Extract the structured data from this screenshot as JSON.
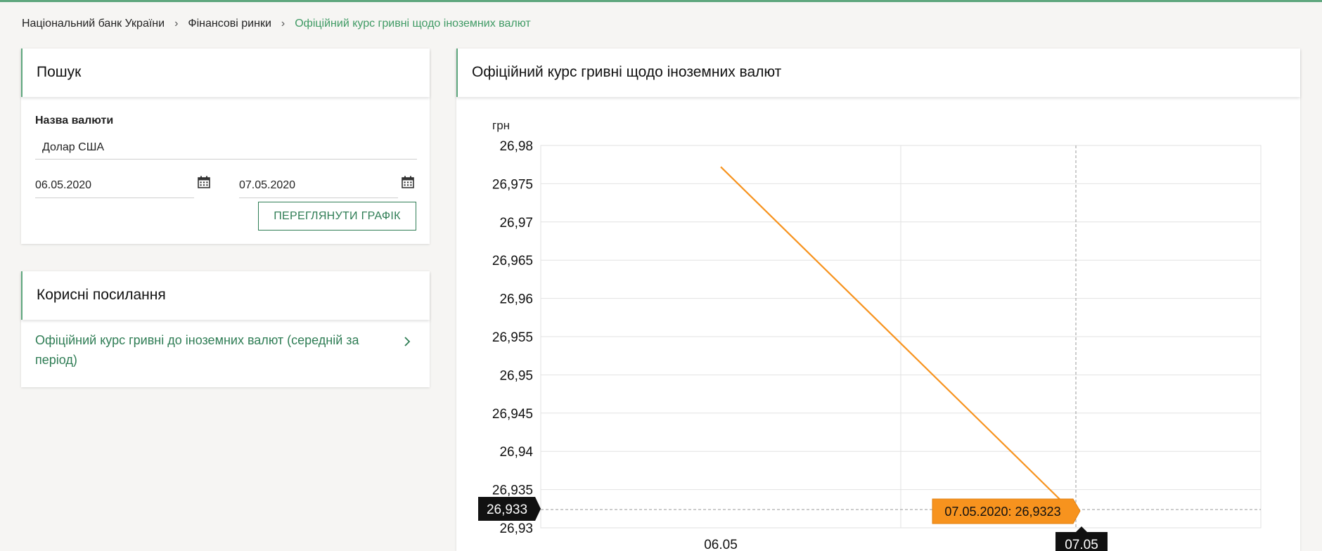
{
  "breadcrumb": {
    "items": [
      "Національний банк України",
      "Фінансові ринки",
      "Офіційний курс гривні щодо іноземних валют"
    ]
  },
  "search": {
    "title": "Пошук",
    "currency_label": "Назва валюти",
    "currency_value": "Долар США",
    "date_from": "06.05.2020",
    "date_to": "07.05.2020",
    "button_label": "ПЕРЕГЛЯНУТИ ГРАФІК"
  },
  "links": {
    "title": "Корисні посилання",
    "items": [
      {
        "line1": "Офіційний курс гривні до іноземних валют (середній за",
        "line2": "період)"
      }
    ]
  },
  "chart_panel": {
    "title": "Офіційний курс гривні щодо іноземних валют"
  },
  "colors": {
    "accent": "#5fa77e",
    "link": "#2f7d55",
    "series": "#f7931e",
    "tooltip_bg": "#f7931e",
    "crosshair_label_bg": "#111111"
  },
  "chart_data": {
    "type": "line",
    "ylabel": "грн",
    "categories": [
      "06.05",
      "07.05"
    ],
    "x": [
      "06.05.2020",
      "07.05.2020"
    ],
    "series": [
      {
        "values": [
          26.9772,
          26.9323
        ]
      }
    ],
    "ylim": [
      26.93,
      26.98
    ],
    "yticks": [
      "26,98",
      "26,975",
      "26,97",
      "26,965",
      "26,96",
      "26,955",
      "26,95",
      "26,945",
      "26,94",
      "26,935",
      "26,93"
    ],
    "grid": true,
    "crosshair": {
      "y_label": "26,933",
      "x_label": "07.05"
    },
    "tooltip": "07.05.2020: 26,9323"
  }
}
